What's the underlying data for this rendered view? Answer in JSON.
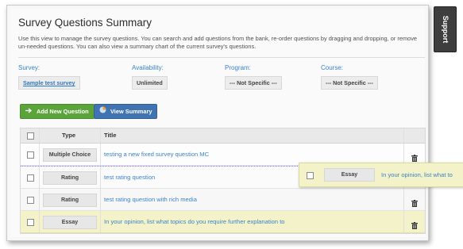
{
  "page": {
    "title": "Survey Questions Summary",
    "description": "Use this view to manage the survey questions. You can search and add questions from the bank, re-order questions by dragging and dropping, or remove un-needed questions. You can also view a summary chart of the current survey's questions."
  },
  "fields": {
    "survey": {
      "label": "Survey:",
      "value": "Sample test survey"
    },
    "availability": {
      "label": "Availability:",
      "value": "Unlimited"
    },
    "program": {
      "label": "Program:",
      "value": "--- Not Specific ---"
    },
    "course": {
      "label": "Course:",
      "value": "--- Not Specific ---"
    }
  },
  "buttons": {
    "add_new_question": "Add New Question",
    "view_summary": "View Summary"
  },
  "table": {
    "headers": {
      "type": "Type",
      "title": "Title"
    },
    "rows": [
      {
        "type": "Multiple Choice",
        "title": "testing a new fixed survey question MC"
      },
      {
        "type": "Rating",
        "title": "test rating question"
      },
      {
        "type": "Rating",
        "title": "test rating question with rich media"
      },
      {
        "type": "Essay",
        "title": "In your opinion, list what topics do you require further explanation to"
      }
    ],
    "drag_ghost": {
      "type": "Essay",
      "title": "In your opinion, list what to"
    }
  },
  "support_tab": "Support",
  "colors": {
    "link": "#3a83c9",
    "green_button": "#5aa43a",
    "blue_button": "#3f73b1",
    "highlight_row": "#f3f2c9"
  }
}
